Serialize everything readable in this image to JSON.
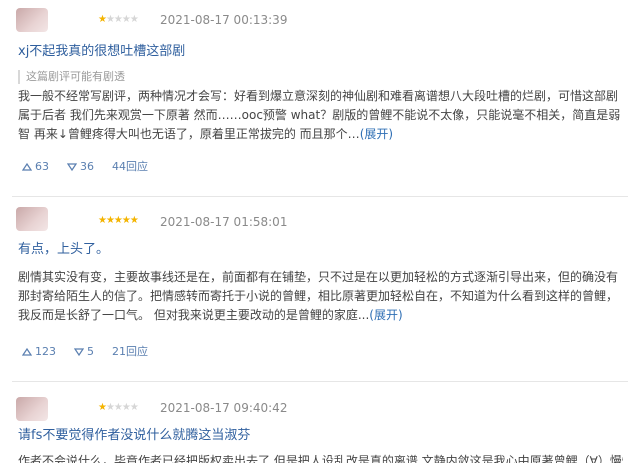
{
  "reviews": [
    {
      "rating": 1,
      "date": "2021-08-17 00:13:39",
      "title": "xj不起我真的很想吐槽这部剧",
      "notice": "这篇剧评可能有剧透",
      "body": "我一般不经常写剧评，两种情况才会写：好看到爆立意深刻的神仙剧和难看离谱想八大段吐槽的烂剧，可惜这部剧属于后者 我们先来观赏一下原著 然而……ooc预警 what？剧版的曾鲤不能说不太像，只能说毫不相关，简直是弱智 再来↓曾鲤疼得大叫也无语了，原着里正常拔完的 而且那个…",
      "more": "(展开)",
      "up": "63",
      "down": "36",
      "replies": "44回应"
    },
    {
      "rating": 5,
      "date": "2021-08-17 01:58:01",
      "title": "有点，上头了。",
      "notice": "",
      "body": "剧情其实没有变，主要故事线还是在，前面都有在铺垫，只不过是在以更加轻松的方式逐渐引导出来，但的确没有那封寄给陌生人的信了。把情感转而寄托于小说的曾鲤，相比原著更加轻松自在，不知道为什么看到这样的曾鲤，我反而是长舒了一口气。 但对我来说更主要改动的是曾鲤的家庭...",
      "more": "(展开)",
      "up": "123",
      "down": "5",
      "replies": "21回应"
    },
    {
      "rating": 1,
      "date": "2021-08-17 09:40:42",
      "title": "请fs不要觉得作者没说什么就腾这当淑芬",
      "notice": "",
      "body": "作者不会说什么，毕竟作者已经把版权卖出去了 但是把人设乱改是真的离谱 文静内敛这是我心中原著曾鲤（∀）慢慢",
      "more": "",
      "up": "",
      "down": "",
      "replies": ""
    }
  ],
  "icons": {
    "avatar": "avatar",
    "upvote": "thumb-up-icon",
    "downvote": "thumb-down-icon",
    "star": "star-icon"
  },
  "colors": {
    "title": "#2f5f9e",
    "link": "#2f6fb5",
    "star": "#f4b400",
    "meta": "#8a8a8a"
  }
}
